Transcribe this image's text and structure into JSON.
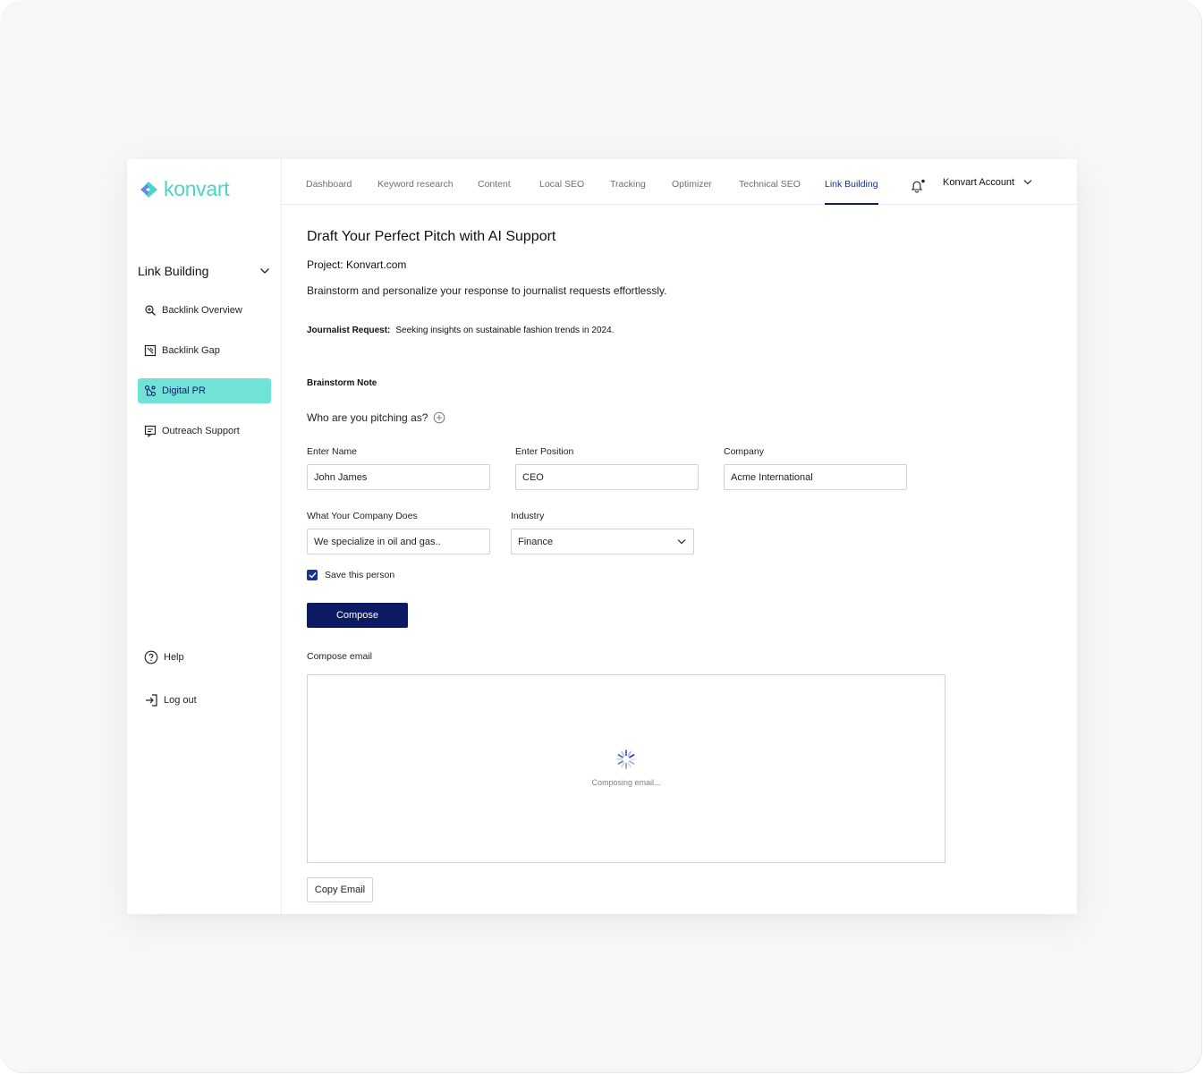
{
  "brand": {
    "name": "konvart",
    "color": "#4fd3c9"
  },
  "sidebar": {
    "section_title": "Link Building",
    "items": [
      {
        "label": "Backlink Overview",
        "icon": "backlink-overview-icon"
      },
      {
        "label": "Backlink Gap",
        "icon": "backlink-gap-icon"
      },
      {
        "label": "Digital PR",
        "icon": "digital-pr-icon",
        "active": true
      },
      {
        "label": "Outreach Support",
        "icon": "outreach-support-icon"
      }
    ],
    "bottom": [
      {
        "label": "Help",
        "icon": "help-icon"
      },
      {
        "label": "Log out",
        "icon": "logout-icon"
      }
    ],
    "active_color": "#70e3d6"
  },
  "topnav": {
    "tabs": [
      {
        "label": "Dashboard"
      },
      {
        "label": "Keyword research"
      },
      {
        "label": "Content"
      },
      {
        "label": "Local SEO"
      },
      {
        "label": "Tracking"
      },
      {
        "label": "Optimizer"
      },
      {
        "label": "Technical SEO"
      },
      {
        "label": "Link Building",
        "active": true
      }
    ],
    "account_label": "Konvart Account"
  },
  "main": {
    "title": "Draft Your Perfect Pitch with AI Support",
    "project": "Project: Konvart.com",
    "description": "Brainstorm and personalize your response to journalist requests effortlessly.",
    "journalist_request_label": "Journalist Request:",
    "journalist_request_value": "Seeking insights on sustainable fashion trends in 2024.",
    "brainstorm_label": "Brainstorm Note",
    "pitching_as": "Who are you pitching as?",
    "fields": {
      "name": {
        "label": "Enter Name",
        "value": "John James"
      },
      "position": {
        "label": "Enter Position",
        "value": "CEO"
      },
      "company": {
        "label": "Company",
        "value": "Acme International"
      },
      "company_does": {
        "label": "What Your Company Does",
        "value": "We specialize in oil and gas.."
      },
      "industry": {
        "label": "Industry",
        "value": "Finance"
      }
    },
    "save_person": {
      "label": "Save this person",
      "checked": true
    },
    "compose_button": "Compose",
    "compose_email_label": "Compose email",
    "composing_status": "Composing email...",
    "copy_button": "Copy Email",
    "primary_color": "#0c1a63"
  }
}
